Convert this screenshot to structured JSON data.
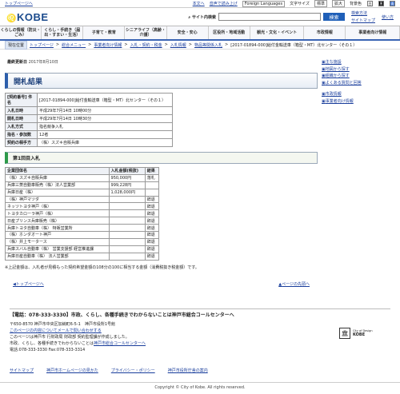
{
  "topbar": {
    "home": "トップページへ",
    "text_size": "本文へ",
    "voice": "音声で読み上げ",
    "lang": "Foreign Languages",
    "lang_sel": "文字サイズ",
    "std": "標準",
    "big": "拡大",
    "bg_label": "背景色",
    "bg1": "白",
    "bg2": "黒",
    "bg3": "青"
  },
  "header": {
    "logo": "KOBE",
    "search_label": "サイト内検索",
    "search_btn": "検索",
    "link1": "検索方法",
    "link2": "使い方",
    "link3": "サイトマップ"
  },
  "nav": [
    "くらしの情報（防災・ごみ）",
    "くらし・手続き（届出・すまい・生活）",
    "子育て・教育",
    "シニアライフ（高齢・介護）",
    "安全・安心",
    "区役所・地域活動",
    "観光・文化・イベント",
    "市政情報",
    "事業者向け情報"
  ],
  "crumb": {
    "here": "現在位置",
    "items": [
      "トップページ",
      "総合メニュー",
      "事業者向け情報",
      "入札・契約・税金",
      "入札情報",
      "物品等関係入札",
      "[2017-01894-000]給付金輸送車（箱型・MT）北センター（その１）"
    ]
  },
  "date": {
    "label": "最終更新日",
    "value": "2017年8月10日"
  },
  "page_title": "開札結果",
  "details": [
    {
      "k": "[契約番号]  件名",
      "v": "[2017-01894-000]給付金輸送車（箱型・MT）北センター（その１）"
    },
    {
      "k": "入札日時",
      "v": "平成29年7月14日 10時00分"
    },
    {
      "k": "開札日時",
      "v": "平成29年7月14日 10時30分"
    },
    {
      "k": "入札方式",
      "v": "指名競争入札"
    },
    {
      "k": "指名・参加数",
      "v": "12者"
    },
    {
      "k": "契約の相手方",
      "v": "（株）スズキ自販兵庫"
    }
  ],
  "section": "第1回目入札",
  "results": {
    "headers": [
      "企業団体名",
      "入札金額(税抜)",
      "結果"
    ],
    "rows": [
      [
        "（株）スズキ自販兵庫",
        "950,000円",
        "落札"
      ],
      [
        "兵庫三菱自動車販売（株）法人営業部",
        "999,228円",
        ""
      ],
      [
        "兵庫日産（株）",
        "1,028,000円",
        ""
      ],
      [
        "（株）神戸マツダ",
        "",
        "辞退"
      ],
      [
        "ネッツトヨタ神戸（株）",
        "",
        "辞退"
      ],
      [
        "トヨタカローラ神戸（株）",
        "",
        "辞退"
      ],
      [
        "日産プリンス兵庫販売（株）",
        "",
        "辞退"
      ],
      [
        "兵庫トヨタ自動車（株） 特販営業所",
        "",
        "辞退"
      ],
      [
        "（株）ホンダオート神戸",
        "",
        "辞退"
      ],
      [
        "（株）井上モータース",
        "",
        "辞退"
      ],
      [
        "兵庫スバル自動車（株） 営業支援部 経営推進課",
        "",
        "辞退"
      ],
      [
        "兵庫日産自動車（株） 法人営業部",
        "",
        "辞退"
      ]
    ]
  },
  "note": "※上記金額は、入札者が見積もった契約希望金額の108分の100に相当する金額（消費税抜き税金額）です。",
  "pnav": {
    "prev": "トップページへ",
    "next": "ページの先頭へ"
  },
  "side": [
    "主な施設",
    "地図から探す",
    "組織から探す",
    "よくある質問と回答",
    "市政情報",
    "事業者向け情報"
  ],
  "call": "【電話：078-333-3330】市政、くらし、各種手続きでわからないことは神戸市総合コールセンターへ",
  "footer": {
    "addr": "〒650-8570 神戸市中央区加納町6-5-1　神戸市役所1号館",
    "q": "このページの内容についてメールで問い合わせする",
    "dept": "このページは神戸市 行財政局 財政部 契約監理課が作成しました。",
    "call2": "市政、くらし、各種手続きでわからないことは",
    "call_link": "神戸市総合コールセンターへ",
    "tel": "電話:078-333-3330 Fax:078-333-3314"
  },
  "fbottom": [
    "サイトマップ",
    "神戸市ホームページの見かた",
    "プライバシー・ポリシー",
    "神戸市役所庁舎の案内"
  ],
  "copyright": "Copyright © City of Kobe. All rights reserved.",
  "unesco": {
    "t1": "City of Design",
    "t2": "KOBE"
  }
}
